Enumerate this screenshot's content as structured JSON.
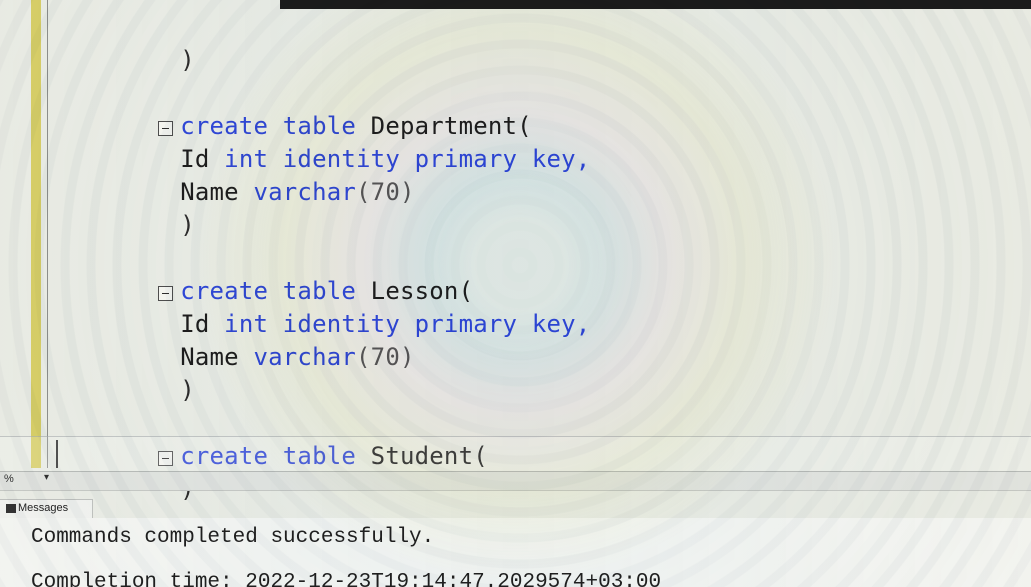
{
  "editor": {
    "lines": [
      {
        "type": "paren",
        "text": ")"
      },
      {
        "type": "blank",
        "text": ""
      },
      {
        "type": "create",
        "kw1": "create",
        "kw2": "table",
        "name": "Department("
      },
      {
        "type": "field",
        "field": "Id",
        "datatype": "int",
        "extra": "identity primary key,"
      },
      {
        "type": "field",
        "field": "Name",
        "datatype": "varchar",
        "extra": "(70)"
      },
      {
        "type": "paren",
        "text": ")"
      },
      {
        "type": "blank",
        "text": ""
      },
      {
        "type": "create",
        "kw1": "create",
        "kw2": "table",
        "name": "Lesson("
      },
      {
        "type": "field",
        "field": "Id",
        "datatype": "int",
        "extra": "identity primary key,"
      },
      {
        "type": "field",
        "field": "Name",
        "datatype": "varchar",
        "extra": "(70)"
      },
      {
        "type": "paren",
        "text": ")"
      },
      {
        "type": "blank",
        "text": ""
      },
      {
        "type": "create",
        "kw1": "create",
        "kw2": "table",
        "name": "Student("
      },
      {
        "type": "paren",
        "text": ")"
      }
    ]
  },
  "status": {
    "zoom": "%",
    "zoom_dropdown": "▾"
  },
  "messages": {
    "tab_label": "Messages",
    "line1": "Commands completed successfully.",
    "line2": "Completion time: 2022-12-23T19:14:47.2029574+03:00"
  },
  "colors": {
    "keyword": "#2f47d6",
    "text": "#1d1d1d",
    "gutter": "#d6cd67"
  },
  "icons": {
    "collapse": "collapse-box-icon",
    "messages": "messages-icon"
  }
}
